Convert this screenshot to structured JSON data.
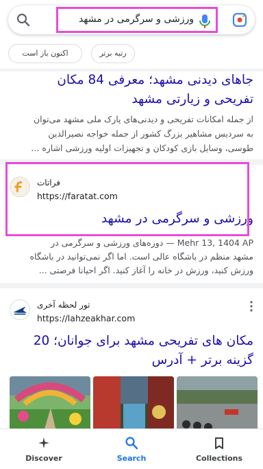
{
  "search": {
    "query": "ورزشی و سرگرمی در مشهد"
  },
  "chips": {
    "best": "رتبه برتر",
    "open_now": "اکنون باز است"
  },
  "result1": {
    "title_line1": "جاهای دیدنی مشهد؛ معرفی 84 مکان",
    "title_line2": "تفریحی و زیارتی مشهد",
    "snippet_line1": "از جمله امکانات تفریحی و دیدنی‌های پارک ملی مشهد می‌توان",
    "snippet_line2": "به سردیس مشاهیر بزرگ کشور از جمله خواجه نصیرالدین",
    "snippet_line3": "طوسی، وسایل بازی کودکان و تجهیزات اولیه ورزشی اشاره ..."
  },
  "result2": {
    "site_name": "فراتات",
    "url": "https://faratat.com",
    "title": "ورزشی و سرگرمی در مشهد",
    "snippet_line1": "Mehr 13, 1404 AP — دوره‌های ورزشی و سرگرمی در",
    "snippet_line2": "مشهد منظم در باشگاه عالی است. اما اگر نمی‌توانید در باشگاه",
    "snippet_line3": "ورزش کنید، ورزش در خانه را آغاز کنید. اگر احیانا فرصتی ..."
  },
  "result3": {
    "site_name": "تور لحظه آخری",
    "url": "https://lahzeakhar.com",
    "title_line1": "مکان های تفریحی مشهد برای جوانان؛ 20",
    "title_line2": "گزینه برتر + آدرس"
  },
  "nav": {
    "discover": "Discover",
    "search": "Search",
    "collections": "Collections"
  },
  "colors": {
    "link": "#1a0dab",
    "highlight": "#e84bd8",
    "active_nav": "#1a73e8"
  },
  "icons": [
    "search-icon",
    "mic-icon",
    "lens-icon",
    "discover-icon",
    "search-nav-icon",
    "collections-icon",
    "more-vert-icon"
  ]
}
